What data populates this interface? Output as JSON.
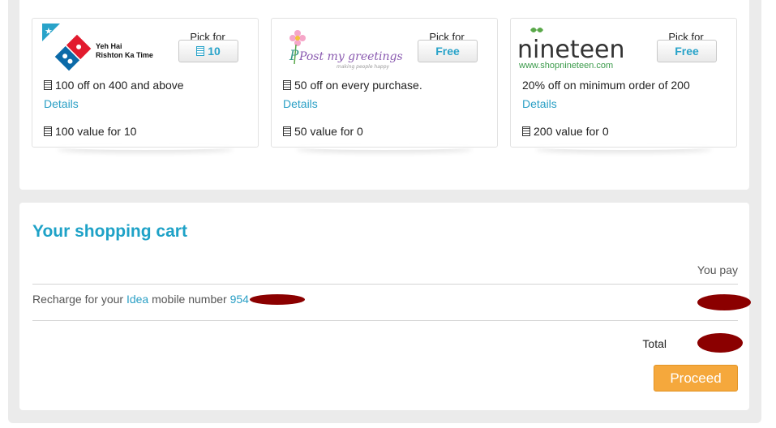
{
  "offers": [
    {
      "brand_tagline": "Yeh Hai Rishton Ka Time",
      "logo_text": "Domino's Pizza",
      "pick_label": "Pick for",
      "pick_price": "10",
      "offer_text": "100 off on  400 and above",
      "details_label": "Details",
      "value_text": "100 value for  10"
    },
    {
      "logo_text": "Post my greetings",
      "logo_subtext": "making people happy",
      "pick_label": "Pick for",
      "pick_price": "Free",
      "offer_text": "50 off on every purchase.",
      "details_label": "Details",
      "value_text": "50 value for  0"
    },
    {
      "logo_text": "nineteen",
      "logo_subtext": "www.shopnineteen.com",
      "pick_label": "Pick for",
      "pick_price": "Free",
      "offer_text": "20% off on minimum order of  200",
      "details_label": "Details",
      "value_text": "200 value for  0"
    }
  ],
  "cart": {
    "title": "Your shopping cart",
    "you_pay_label": "You pay",
    "recharge_prefix": "Recharge for your ",
    "operator": "Idea",
    "recharge_middle": " mobile number ",
    "number_prefix": "954",
    "total_label": "Total",
    "proceed_label": "Proceed"
  },
  "colors": {
    "accent": "#1ea2c7",
    "link": "#2a9fc5",
    "proceed": "#f5a83c",
    "redaction": "#8b0000"
  }
}
